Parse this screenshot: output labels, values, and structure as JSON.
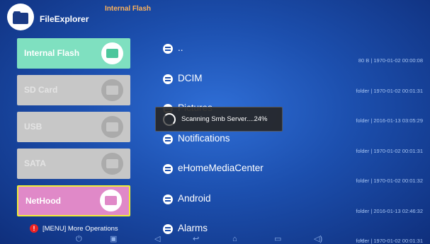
{
  "header": {
    "app_title": "FileExplorer",
    "breadcrumb": "Internal Flash",
    "logo_icon": "folder-icon"
  },
  "sidebar": {
    "items": [
      {
        "label": "Internal Flash",
        "state": "active",
        "icon": "flash-chip-icon"
      },
      {
        "label": "SD Card",
        "state": "disabled",
        "icon": "sd-card-icon"
      },
      {
        "label": "USB",
        "state": "disabled",
        "icon": "usb-icon"
      },
      {
        "label": "SATA",
        "state": "disabled",
        "icon": "sata-icon"
      },
      {
        "label": "NetHood",
        "state": "focused",
        "icon": "network-icon"
      }
    ],
    "menu_hint": "[MENU] More Operations",
    "hint_icon": "warning-icon"
  },
  "files": [
    {
      "name": "..",
      "meta": "80 B | 1970-01-02 00:00:08"
    },
    {
      "name": "DCIM",
      "meta": "folder | 1970-01-02 00:01:31"
    },
    {
      "name": "Pictures",
      "meta": "folder | 2016-01-13 03:05:29"
    },
    {
      "name": "Notifications",
      "meta": "folder | 1970-01-02 00:01:31"
    },
    {
      "name": "eHomeMediaCenter",
      "meta": "folder | 1970-01-02 00:01:32"
    },
    {
      "name": "Android",
      "meta": "folder | 2016-01-13 02:46:32"
    },
    {
      "name": "Alarms",
      "meta": "folder | 1970-01-02 00:01:31"
    }
  ],
  "scan_toast": {
    "text": "Scanning Smb Server....24%",
    "progress_percent": 24
  },
  "navbar": {
    "icons": [
      "power-icon",
      "screenshot-icon",
      "volume-down-icon",
      "back-icon",
      "home-icon",
      "recent-apps-icon",
      "volume-up-icon",
      "menu-chevron-icon"
    ]
  },
  "colors": {
    "background": "#1c4fae",
    "accent_flash": "#7fe0c0",
    "nethood": "#e089c8",
    "focus_border": "#f1ee36",
    "breadcrumb": "#ffb35a"
  }
}
